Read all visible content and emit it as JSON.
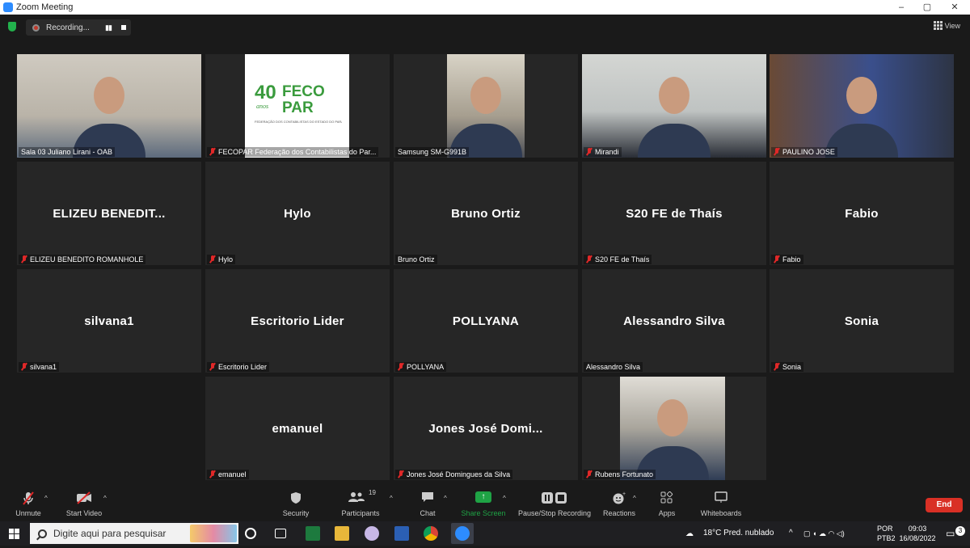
{
  "window": {
    "title": "Zoom Meeting",
    "controls": [
      "–",
      "▢",
      "✕"
    ]
  },
  "topbar": {
    "recording_label": "Recording...",
    "view_label": "View"
  },
  "tiles": [
    {
      "big": "",
      "tag": "Sala 03 Juliano Lirani - OAB",
      "muted": false,
      "video": "person",
      "active": true
    },
    {
      "big": "",
      "tag": "FECOPAR Federação dos Contabilistas do Par...",
      "muted": true,
      "video": "logo"
    },
    {
      "big": "",
      "tag": "Samsung SM-G991B",
      "muted": false,
      "video": "person"
    },
    {
      "big": "",
      "tag": "Mirandi",
      "muted": true,
      "video": "person"
    },
    {
      "big": "",
      "tag": "PAULINO JOSE",
      "muted": true,
      "video": "person"
    },
    {
      "big": "ELIZEU  BENEDIT...",
      "tag": "ELIZEU BENEDITO ROMANHOLE",
      "muted": true
    },
    {
      "big": "Hylo",
      "tag": "Hylo",
      "muted": true
    },
    {
      "big": "Bruno Ortiz",
      "tag": "Bruno Ortiz",
      "muted": false
    },
    {
      "big": "S20 FE de Thaís",
      "tag": "S20 FE de Thaís",
      "muted": true
    },
    {
      "big": "Fabio",
      "tag": "Fabio",
      "muted": true
    },
    {
      "big": "silvana1",
      "tag": "silvana1",
      "muted": true
    },
    {
      "big": "Escritorio Lider",
      "tag": "Escritorio Lider",
      "muted": true
    },
    {
      "big": "POLLYANA",
      "tag": "POLLYANA",
      "muted": true
    },
    {
      "big": "Alessandro Silva",
      "tag": "Alessandro Silva",
      "muted": false
    },
    {
      "big": "Sonia",
      "tag": "Sonia",
      "muted": true
    },
    {
      "big": "emanuel",
      "tag": "emanuel",
      "muted": true
    },
    {
      "big": "Jones  José  Domi...",
      "tag": "Jones José Domingues da Silva",
      "muted": true
    },
    {
      "big": "",
      "tag": "Rubens Fortunato",
      "muted": true,
      "video": "person"
    }
  ],
  "fecopar_logo": {
    "number": "40",
    "sub": "anos",
    "line1": "FECO",
    "line2": "PAR",
    "caption": "FEDERAÇÃO DOS CONTABILISTAS DO ESTADO DO PARANÁ"
  },
  "toolbar": {
    "unmute": "Unmute",
    "start_video": "Start Video",
    "security": "Security",
    "participants": "Participants",
    "participants_count": "19",
    "chat": "Chat",
    "share_screen": "Share Screen",
    "recording": "Pause/Stop Recording",
    "reactions": "Reactions",
    "apps": "Apps",
    "whiteboards": "Whiteboards",
    "end": "End"
  },
  "taskbar": {
    "search_placeholder": "Digite aqui para pesquisar",
    "weather": "18°C  Pred. nublado",
    "lang1": "POR",
    "lang2": "PTB2",
    "time": "09:03",
    "date": "16/08/2022",
    "notifications": "3"
  },
  "colors": {
    "active_speaker": "#e6e667",
    "share": "#1fa345",
    "end": "#d93025",
    "muted": "#e02828"
  }
}
